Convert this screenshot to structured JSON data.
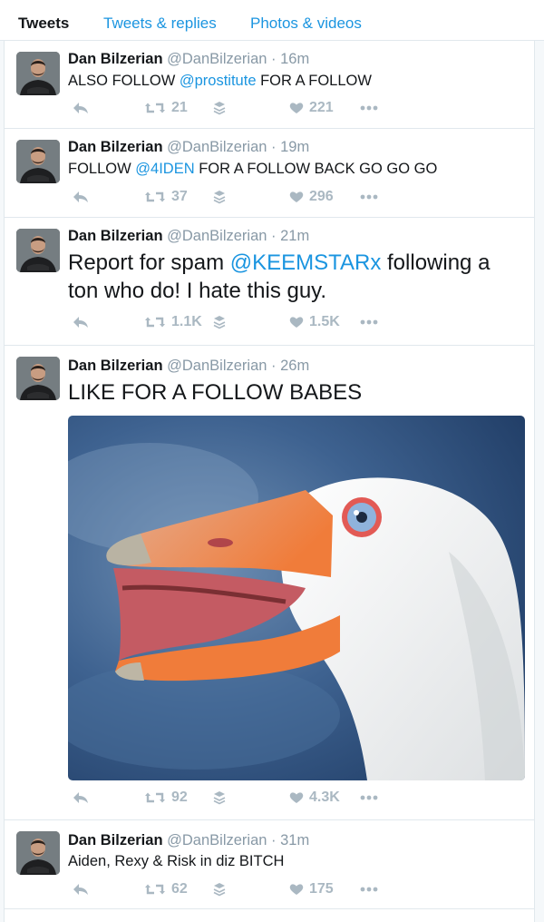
{
  "nav": {
    "tabs": [
      {
        "label": "Tweets",
        "active": true
      },
      {
        "label": "Tweets & replies",
        "active": false
      },
      {
        "label": "Photos & videos",
        "active": false
      }
    ]
  },
  "colors": {
    "link": "#1b95e0",
    "muted": "#8899a6",
    "action": "#aab8c2"
  },
  "tweets": [
    {
      "name": "Dan Bilzerian",
      "handle": "@DanBilzerian",
      "time": "16m",
      "text_before": "ALSO FOLLOW ",
      "mention": "@prostitute",
      "text_after": " FOR A FOLLOW",
      "retweets": "21",
      "likes": "221"
    },
    {
      "name": "Dan Bilzerian",
      "handle": "@DanBilzerian",
      "time": "19m",
      "text_before": "FOLLOW ",
      "mention": "@4IDEN",
      "text_after": " FOR A FOLLOW BACK GO GO GO",
      "retweets": "37",
      "likes": "296"
    },
    {
      "name": "Dan Bilzerian",
      "handle": "@DanBilzerian",
      "time": "21m",
      "text_before": "Report for spam ",
      "mention": "@KEEMSTARx",
      "text_after": " following a",
      "text_line2": "ton who do! I hate this guy.",
      "retweets": "1.1K",
      "likes": "1.5K"
    },
    {
      "name": "Dan Bilzerian",
      "handle": "@DanBilzerian",
      "time": "26m",
      "text": "LIKE FOR A FOLLOW BABES",
      "image": "goose-photo",
      "retweets": "92",
      "likes": "4.3K"
    },
    {
      "name": "Dan Bilzerian",
      "handle": "@DanBilzerian",
      "time": "31m",
      "text": "Aiden, Rexy & Risk in diz BITCH",
      "retweets": "62",
      "likes": "175"
    }
  ],
  "icons": [
    "reply-icon",
    "retweet-icon",
    "buffer-icon",
    "heart-icon",
    "more-icon"
  ]
}
